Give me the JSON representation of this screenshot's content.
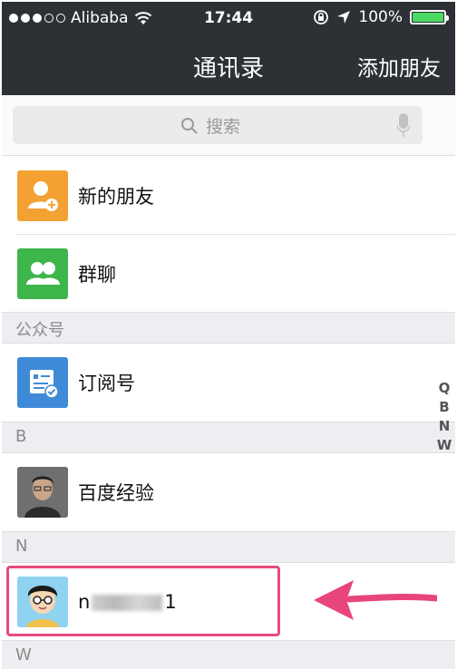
{
  "status_bar": {
    "carrier": "Alibaba",
    "time": "17:44",
    "battery": "100%"
  },
  "nav": {
    "title": "通讯录",
    "add_friend": "添加朋友"
  },
  "search": {
    "placeholder": "搜索"
  },
  "top_items": [
    {
      "label": "新的朋友",
      "icon": "new-friend-icon",
      "color": "#f4a134"
    },
    {
      "label": "群聊",
      "icon": "group-chat-icon",
      "color": "#3fb64b"
    }
  ],
  "sections": [
    {
      "header": "公众号",
      "items": [
        {
          "label": "订阅号",
          "icon": "subscription-icon",
          "color": "#3f8ad6"
        }
      ]
    },
    {
      "header": "B",
      "items": [
        {
          "label": "百度经验",
          "icon": "photo-avatar"
        }
      ]
    },
    {
      "header": "N",
      "items": [
        {
          "label_prefix": "n",
          "label_suffix": "1",
          "icon": "cartoon-avatar"
        }
      ]
    },
    {
      "header": "W",
      "items": []
    }
  ],
  "index_letters": [
    "Q",
    "B",
    "N",
    "W"
  ],
  "colors": {
    "nav_background": "#2d3035",
    "highlight": "#e64a7c",
    "battery": "#4cd964"
  }
}
